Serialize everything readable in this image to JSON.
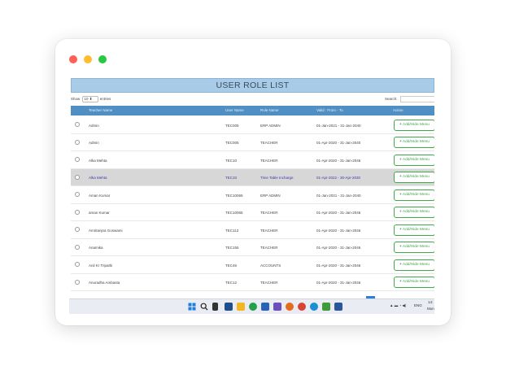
{
  "window": {
    "title": "USER ROLE LIST"
  },
  "controls": {
    "show_label": "Show",
    "entries_value": "10",
    "entries_label": "entries",
    "search_label": "Search:"
  },
  "table": {
    "headers": {
      "teacher_name": "Teacher Name",
      "user_name": "User Name",
      "role_name": "Role Name",
      "valid_from_to": "Valid : From - To",
      "action": "Action"
    },
    "action_label": "Add/Hide Menu",
    "rows": [
      {
        "teacher_name": "Admin",
        "user_name": "TEC005",
        "role_name": "ERP ADMIN",
        "valid": "01-Jan-2021 - 31-Jan-2040"
      },
      {
        "teacher_name": "Admin",
        "user_name": "TEC005",
        "role_name": "TEACHER",
        "valid": "01-Apr-2020 - 31-Jan-2040"
      },
      {
        "teacher_name": "Alka Mehta",
        "user_name": "TEC10",
        "role_name": "TEACHER",
        "valid": "01-Apr-2020 - 31-Jan-2046"
      },
      {
        "teacher_name": "Alka Mehta",
        "user_name": "TEC10",
        "role_name": "Time Table Incharge",
        "valid": "01-Apr-2022 - 30-Apr-2030"
      },
      {
        "teacher_name": "Aman Kumar",
        "user_name": "TEC10065",
        "role_name": "ERP ADMIN",
        "valid": "01-Jan-2021 - 31-Jan-2040"
      },
      {
        "teacher_name": "aman Kumar",
        "user_name": "TEC10065",
        "role_name": "TEACHER",
        "valid": "01-Apr-2020 - 31-Jan-2046"
      },
      {
        "teacher_name": "Amritanjna Goswami",
        "user_name": "TEC113",
        "role_name": "TEACHER",
        "valid": "01-Apr-2020 - 31-Jan-2046"
      },
      {
        "teacher_name": "Anamika",
        "user_name": "TEC155",
        "role_name": "TEACHER",
        "valid": "01-Apr-2020 - 31-Jan-2046"
      },
      {
        "teacher_name": "Anil Kr Tripathi",
        "user_name": "TEC46",
        "role_name": "ACCOUNTS",
        "valid": "01-Apr-2020 - 31-Jan-2046"
      },
      {
        "teacher_name": "Anuradha Ambasta",
        "user_name": "TEC12",
        "role_name": "TEACHER",
        "valid": "01-Apr-2020 - 31-Jan-2046"
      }
    ]
  },
  "taskbar": {
    "language": "ENG",
    "time": "14:",
    "date": "Mon"
  },
  "colors": {
    "title_bar": "#a8cbe8",
    "table_header": "#4f8fc3",
    "highlight_row": "#d7d7d7",
    "action_button": "#3fa84a",
    "close": "#fe5f57",
    "minimize": "#febc2e",
    "maximize": "#28c840"
  },
  "icons": {
    "close": "close-dot-icon",
    "minimize": "minimize-dot-icon",
    "maximize": "maximize-dot-icon",
    "add": "plus-icon",
    "start": "windows-start-icon",
    "search": "search-icon"
  }
}
